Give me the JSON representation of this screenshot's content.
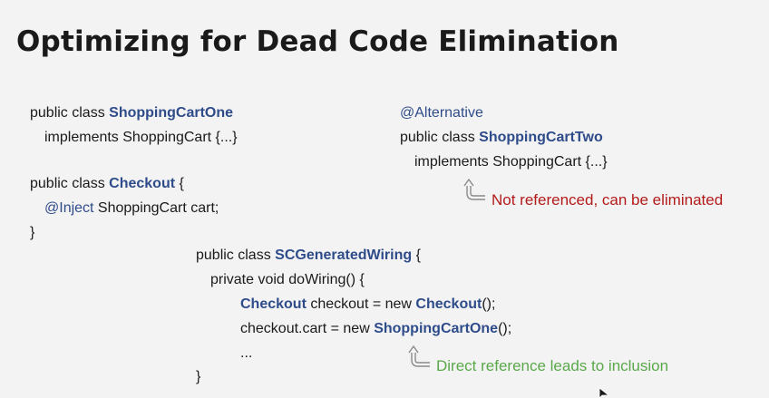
{
  "slide": {
    "title": "Optimizing for Dead Code Elimination"
  },
  "code_left": {
    "l1_prefix": "public class ",
    "l1_class": "ShoppingCartOne",
    "l2": "implements ShoppingCart {...}",
    "l3_prefix": "public class ",
    "l3_class": "Checkout",
    "l3_suffix": " {",
    "l4_annotation": "@Inject",
    "l4_rest": " ShoppingCart cart;",
    "l5": "}"
  },
  "code_right": {
    "l1_annotation": "@Alternative",
    "l2_prefix": "public class ",
    "l2_class": "ShoppingCartTwo",
    "l3": "implements ShoppingCart {...}"
  },
  "code_bottom": {
    "l1_prefix": "public class ",
    "l1_class": "SCGeneratedWiring",
    "l1_suffix": " {",
    "l2": "private void doWiring() {",
    "l3_class": "Checkout",
    "l3_mid": " checkout = new ",
    "l3_class2": "Checkout",
    "l3_suffix": "();",
    "l4_prefix": "checkout.cart = new ",
    "l4_class": "ShoppingCartOne",
    "l4_suffix": "();",
    "l5": "...",
    "l6": "}"
  },
  "notes": {
    "not_referenced": "Not referenced, can be eliminated",
    "direct_reference": "Direct reference leads to inclusion"
  },
  "colors": {
    "highlight": "#2f4c8a",
    "red_note": "#b31b1b",
    "green_note": "#5aa84a",
    "background": "#f3f3f3"
  },
  "icons": {
    "arrow": "curved-up-arrow-icon",
    "cursor": "mouse-pointer-icon"
  }
}
